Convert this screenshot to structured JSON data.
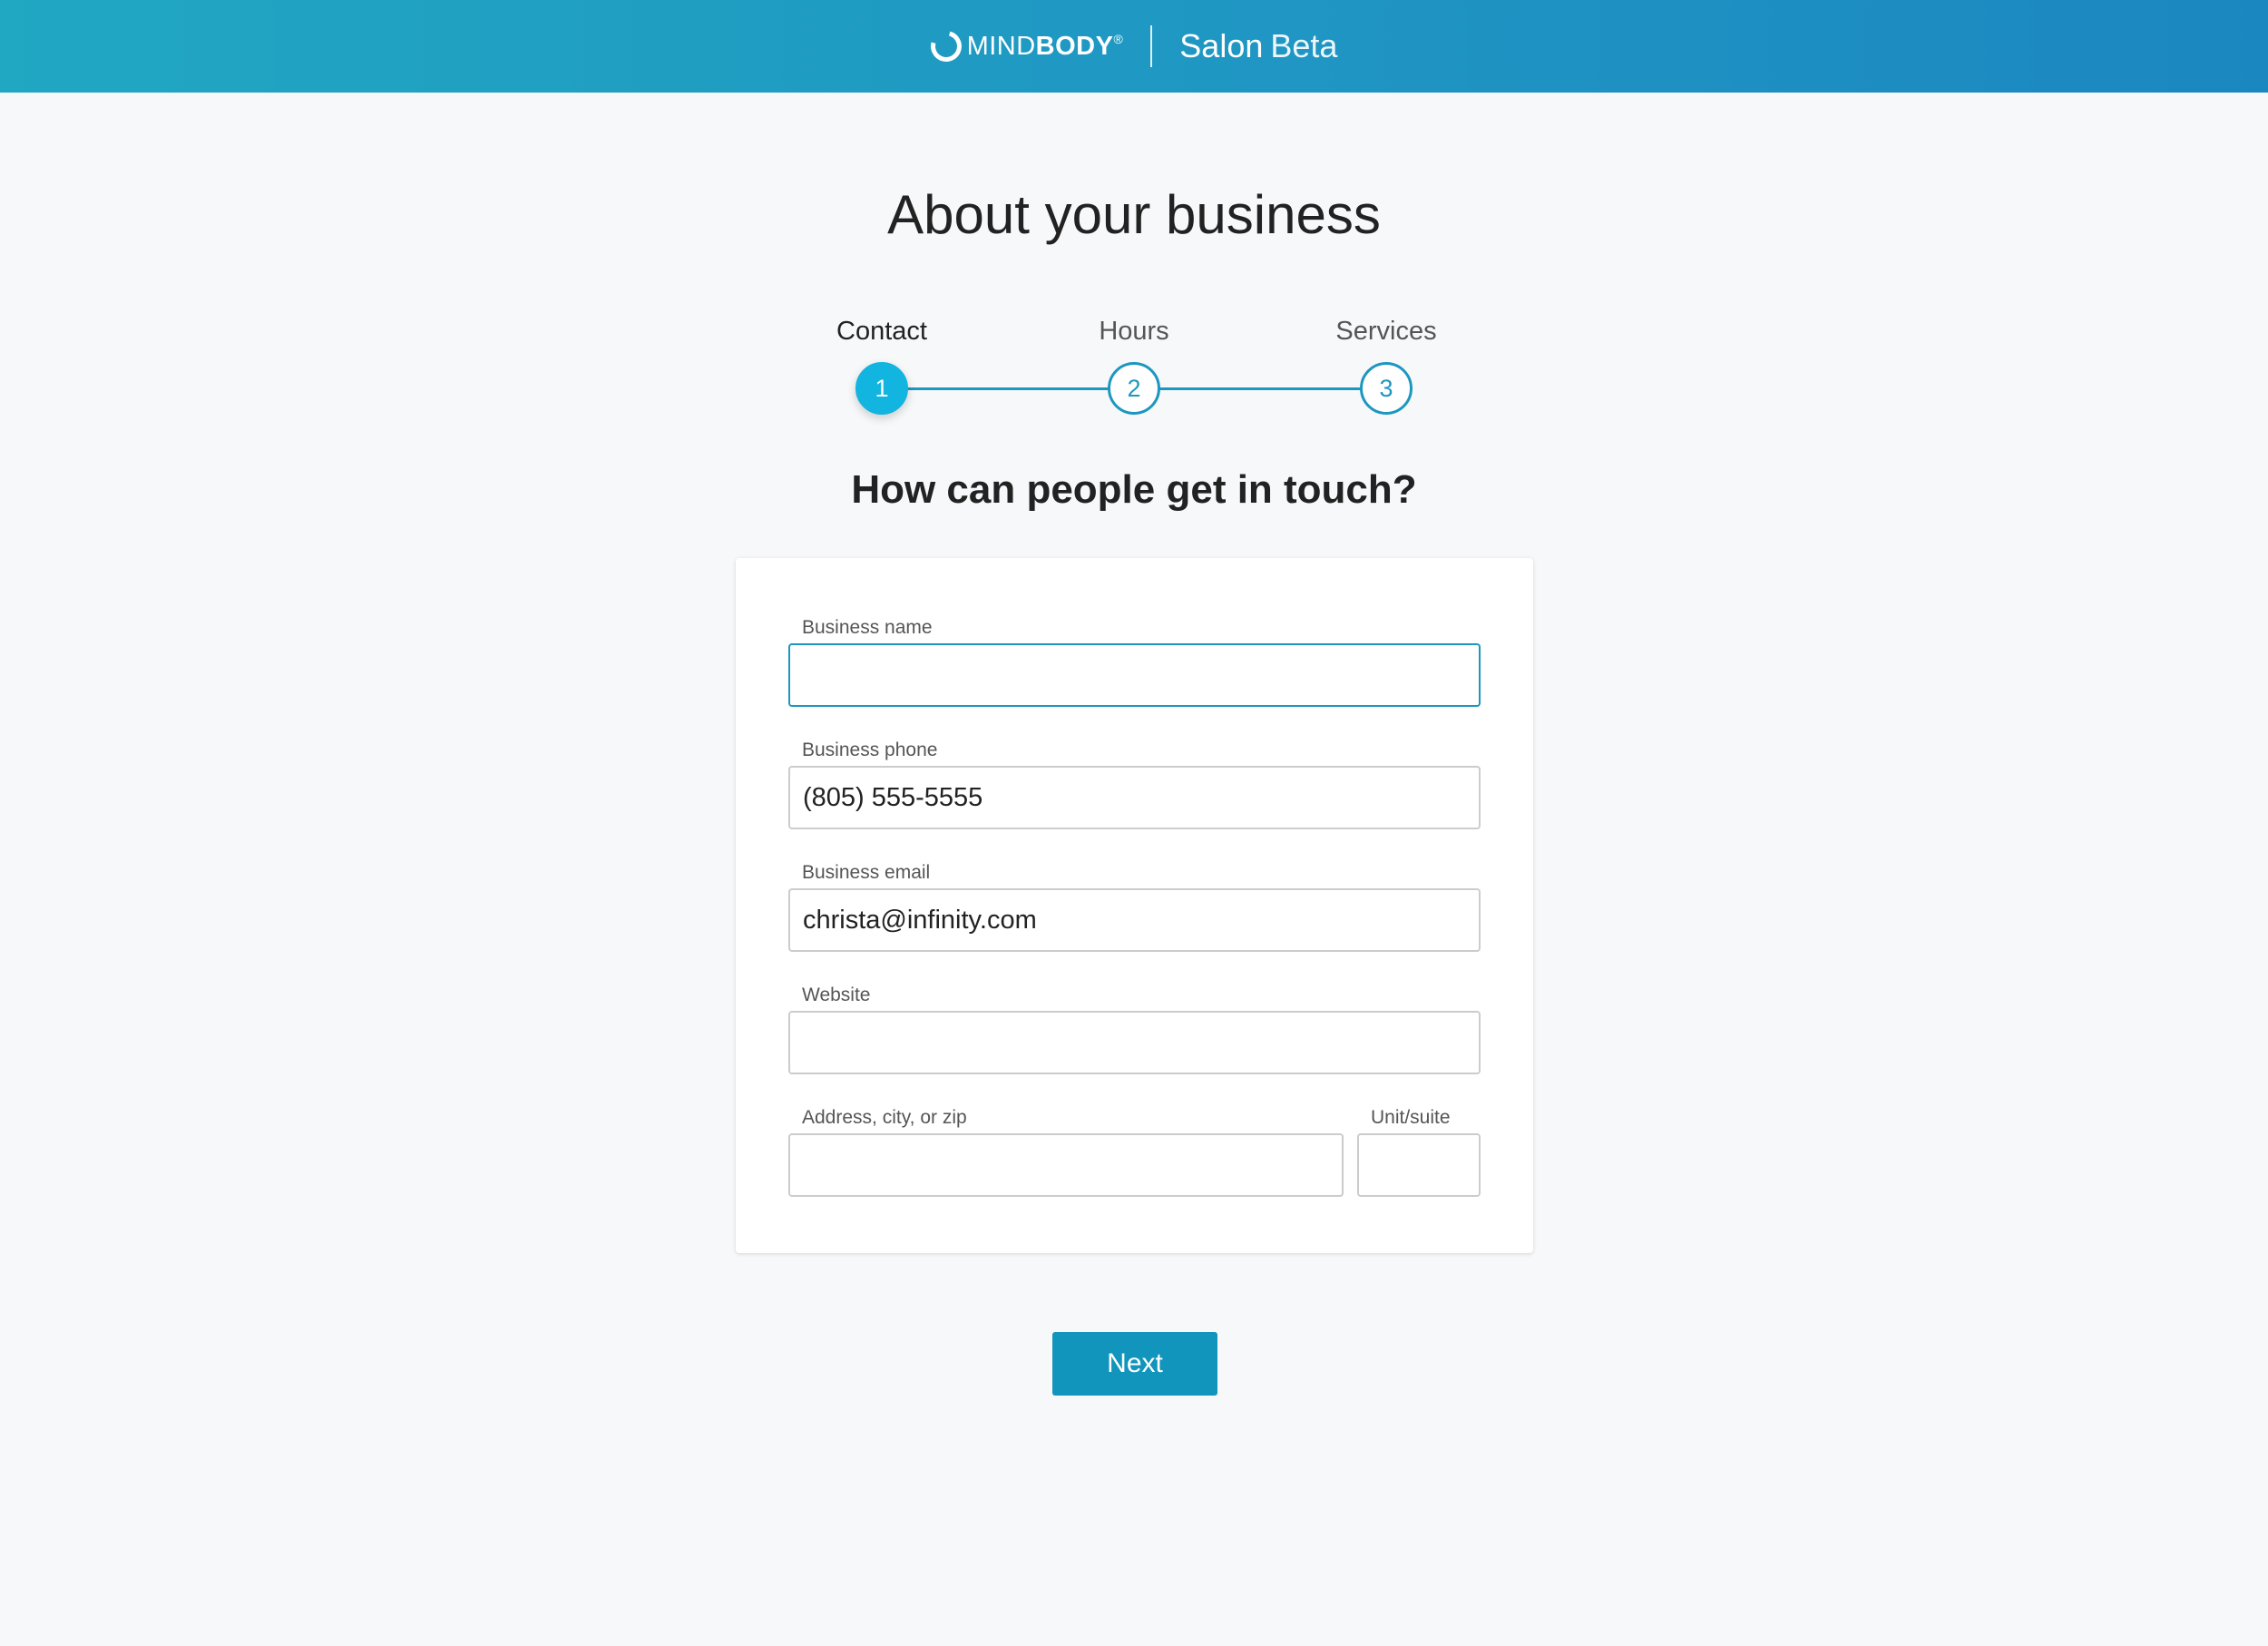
{
  "header": {
    "logo_thin": "MIND",
    "logo_bold": "BODY",
    "logo_mark": "®",
    "product_name": "Salon",
    "product_tag": "Beta"
  },
  "page": {
    "title": "About your business",
    "subtitle": "How can people get in touch?"
  },
  "stepper": {
    "steps": [
      {
        "label": "Contact",
        "number": "1",
        "active": true
      },
      {
        "label": "Hours",
        "number": "2",
        "active": false
      },
      {
        "label": "Services",
        "number": "3",
        "active": false
      }
    ]
  },
  "form": {
    "business_name": {
      "label": "Business name",
      "value": ""
    },
    "business_phone": {
      "label": "Business phone",
      "value": "(805) 555-5555"
    },
    "business_email": {
      "label": "Business email",
      "value": "christa@infinity.com"
    },
    "website": {
      "label": "Website",
      "value": ""
    },
    "address": {
      "label": "Address, city, or zip",
      "value": ""
    },
    "unit": {
      "label": "Unit/suite",
      "value": ""
    }
  },
  "actions": {
    "next_label": "Next"
  },
  "colors": {
    "header_gradient_start": "#20a7c2",
    "header_gradient_end": "#1b87c0",
    "accent": "#1d97bf",
    "active_step": "#12b4e0",
    "button": "#1295bd"
  }
}
